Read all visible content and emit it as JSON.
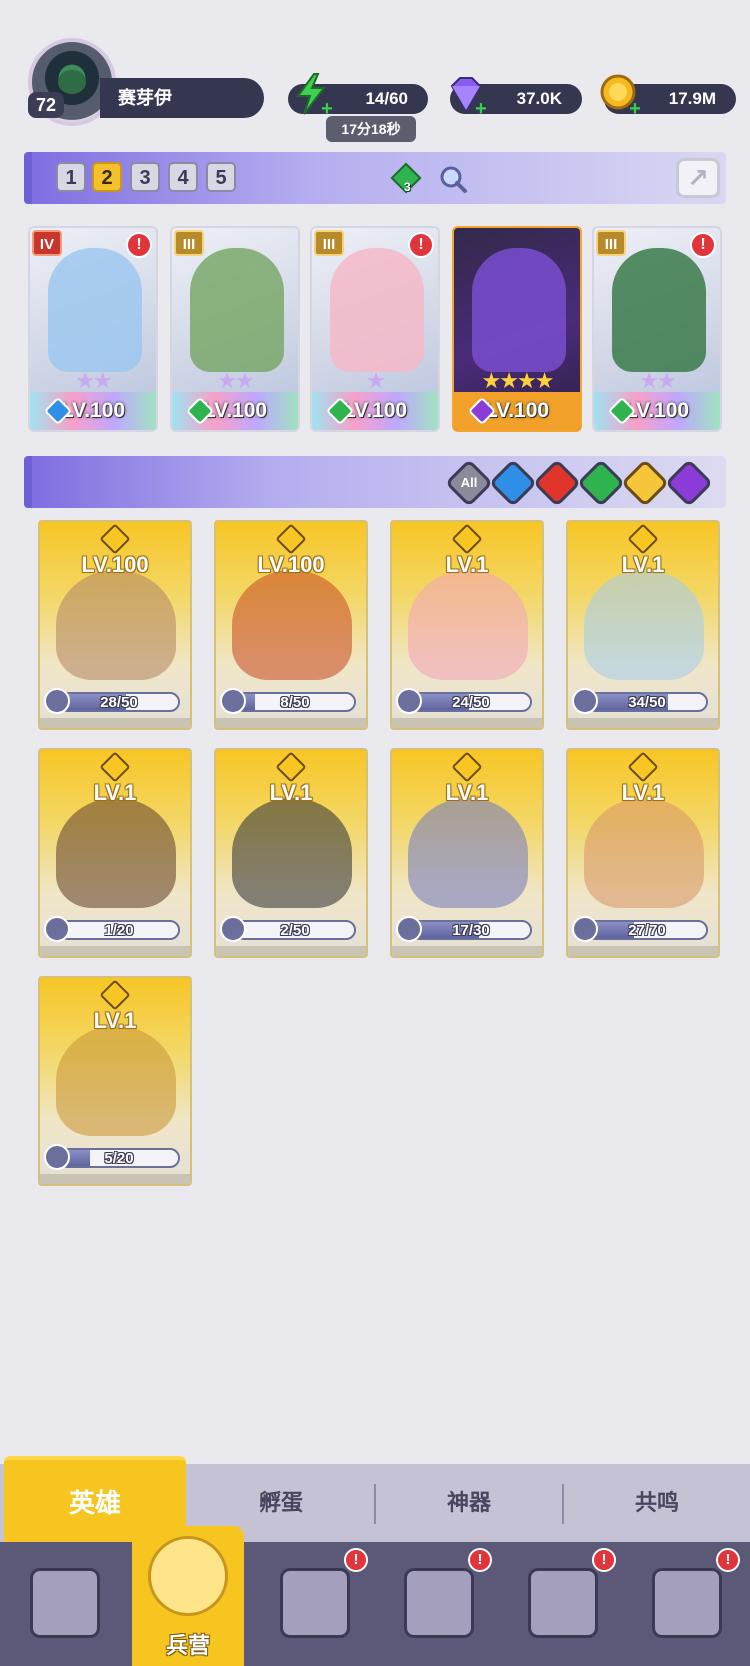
{
  "player": {
    "level": "72",
    "name": "赛芽伊"
  },
  "resources": {
    "energy": {
      "value": "14/60",
      "timer": "17分18秒",
      "icon": "lightning-icon",
      "color": "#35d04a"
    },
    "gems": {
      "value": "37.0K",
      "icon": "purple-gem-icon",
      "color": "#8a5cf0"
    },
    "gold": {
      "value": "17.9M",
      "icon": "gold-coin-icon",
      "color": "#f5b820"
    }
  },
  "team": {
    "tabs": [
      "1",
      "2",
      "3",
      "4",
      "5"
    ],
    "active_tab": "2",
    "gem_badge": "3",
    "share_icon": "share-icon",
    "search_icon": "magnifier-icon",
    "cards": [
      {
        "rank": "IV",
        "rank_style": "red",
        "level": "LV.100",
        "stars": "★★",
        "element": "water",
        "element_color": "#2f8ee6",
        "alert": "!",
        "style": "normal",
        "art_color": "#9ec8f0"
      },
      {
        "rank": "III",
        "rank_style": "gold",
        "level": "LV.100",
        "stars": "★★",
        "element": "nature",
        "element_color": "#2fb34f",
        "alert": "",
        "style": "normal",
        "art_color": "#7aa86a"
      },
      {
        "rank": "III",
        "rank_style": "gold",
        "level": "LV.100",
        "stars": "★",
        "element": "nature",
        "element_color": "#2fb34f",
        "alert": "!",
        "style": "normal",
        "art_color": "#f4b8c8"
      },
      {
        "rank": "",
        "rank_style": "",
        "level": "LV.100",
        "stars": "★★★★",
        "element": "dark",
        "element_color": "#8a3bd8",
        "alert": "",
        "style": "violet",
        "art_color": "#7a4ed0"
      },
      {
        "rank": "III",
        "rank_style": "gold",
        "level": "LV.100",
        "stars": "★★",
        "element": "nature",
        "element_color": "#2fb34f",
        "alert": "!",
        "style": "normal",
        "art_color": "#3a7a4a"
      }
    ]
  },
  "filters": [
    {
      "label": "All",
      "color": "#8a8a9a",
      "icon": "all-filter-icon"
    },
    {
      "label": "",
      "color": "#2f8ee6",
      "icon": "water-drop-icon"
    },
    {
      "label": "",
      "color": "#e0352b",
      "icon": "fire-icon"
    },
    {
      "label": "",
      "color": "#2fb34f",
      "icon": "leaf-icon"
    },
    {
      "label": "",
      "color": "#f5c63a",
      "icon": "light-star-icon"
    },
    {
      "label": "",
      "color": "#8a3bd8",
      "icon": "dark-moon-icon"
    }
  ],
  "heroes": [
    {
      "level": "LV.100",
      "progress_text": "28/50",
      "progress": 0.56,
      "art_color": "#b58a66"
    },
    {
      "level": "LV.100",
      "progress_text": "8/50",
      "progress": 0.16,
      "art_color": "#c9542a"
    },
    {
      "level": "LV.1",
      "progress_text": "24/50",
      "progress": 0.48,
      "art_color": "#f1a6b8"
    },
    {
      "level": "LV.1",
      "progress_text": "34/50",
      "progress": 0.68,
      "art_color": "#a8cde8"
    },
    {
      "level": "LV.1",
      "progress_text": "1/20",
      "progress": 0.05,
      "art_color": "#6a4a32"
    },
    {
      "level": "LV.1",
      "progress_text": "2/50",
      "progress": 0.04,
      "art_color": "#3a3a3a"
    },
    {
      "level": "LV.1",
      "progress_text": "17/30",
      "progress": 0.57,
      "art_color": "#7a7fc0"
    },
    {
      "level": "LV.1",
      "progress_text": "27/70",
      "progress": 0.39,
      "art_color": "#d89a6a"
    },
    {
      "level": "LV.1",
      "progress_text": "5/20",
      "progress": 0.25,
      "art_color": "#c99a3a"
    }
  ],
  "sub_tabs": [
    "英雄",
    "孵蛋",
    "神器",
    "共鸣"
  ],
  "nav": [
    {
      "label": "",
      "icon": "cards-icon",
      "alert": ""
    },
    {
      "label": "兵营",
      "icon": "barracks-icon",
      "alert": ""
    },
    {
      "label": "",
      "icon": "book-icon",
      "alert": "!"
    },
    {
      "label": "",
      "icon": "temple-icon",
      "alert": "!"
    },
    {
      "label": "",
      "icon": "mushroom-icon",
      "alert": "!"
    },
    {
      "label": "",
      "icon": "banner-icon",
      "alert": "!"
    }
  ]
}
